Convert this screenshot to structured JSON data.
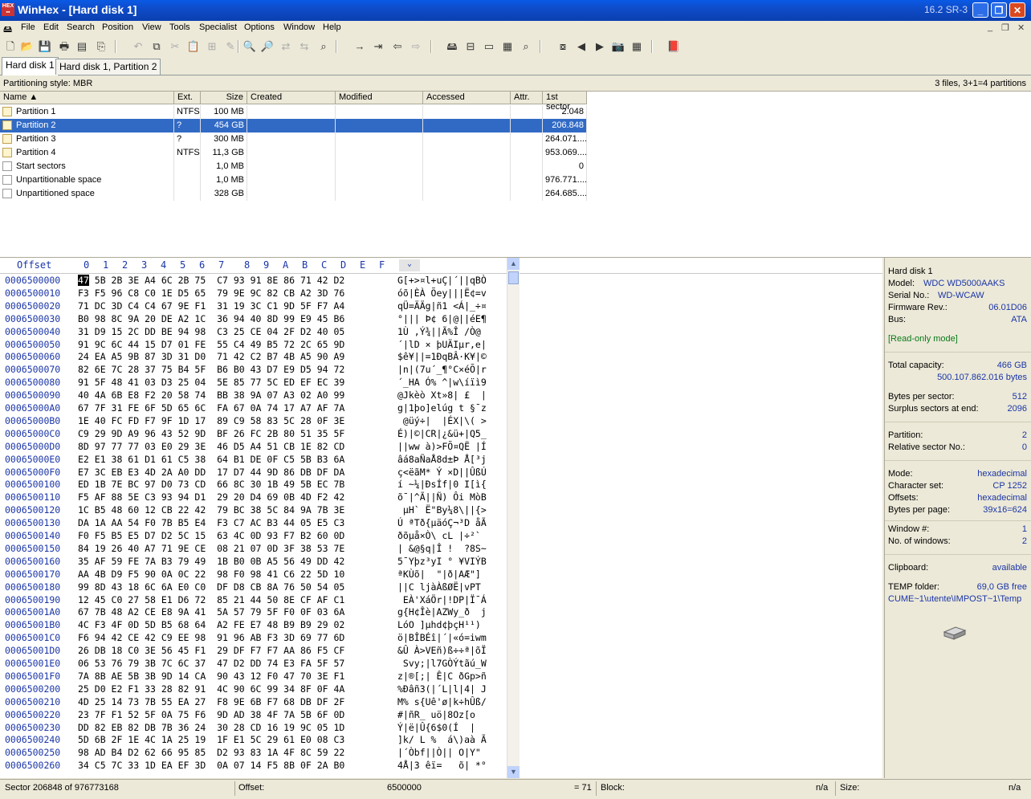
{
  "window": {
    "title": "WinHex - [Hard disk 1]",
    "version": "16.2 SR-3",
    "app_icon": "hex-icon"
  },
  "menu": [
    "File",
    "Edit",
    "Search",
    "Position",
    "View",
    "Tools",
    "Specialist",
    "Options",
    "Window",
    "Help"
  ],
  "tabs": [
    "Hard disk 1",
    "Hard disk 1, Partition 2"
  ],
  "partition_style": "Partitioning style: MBR",
  "files_summary": "3 files, 3+1=4 partitions",
  "columns": [
    "Name ▲",
    "Ext.",
    "Size",
    "Created",
    "Modified",
    "Accessed",
    "Attr.",
    "1st sector"
  ],
  "partitions": [
    {
      "name": "Partition 1",
      "ext": "NTFS",
      "size": "100 MB",
      "sector": "2.048",
      "icon": "partition-icon"
    },
    {
      "name": "Partition 2",
      "ext": "?",
      "size": "454 GB",
      "sector": "206.848",
      "icon": "partition-icon",
      "selected": true
    },
    {
      "name": "Partition 3",
      "ext": "?",
      "size": "300 MB",
      "sector": "264.071....",
      "icon": "partition-icon"
    },
    {
      "name": "Partition 4",
      "ext": "NTFS",
      "size": "11,3 GB",
      "sector": "953.069....",
      "icon": "partition-icon"
    },
    {
      "name": "Start sectors",
      "ext": "",
      "size": "1,0 MB",
      "sector": "0",
      "icon": "document-icon"
    },
    {
      "name": "Unpartitionable space",
      "ext": "",
      "size": "1,0 MB",
      "sector": "976.771....",
      "icon": "document-icon"
    },
    {
      "name": "Unpartitioned space",
      "ext": "",
      "size": "328 GB",
      "sector": "264.685....",
      "icon": "document-icon"
    }
  ],
  "hex_header": {
    "offset": "Offset",
    "cols": [
      "0",
      "1",
      "2",
      "3",
      "4",
      "5",
      "6",
      "7",
      "8",
      "9",
      "A",
      "B",
      "C",
      "D",
      "E",
      "F"
    ]
  },
  "hex_rows": [
    {
      "off": "0006500000",
      "hex": "47 5B 2B 3E A4 6C 2B 75  C7 93 91 8E 86 71 42 D2",
      "txt": "G[+>¤l+uÇ|´||qBÒ"
    },
    {
      "off": "0006500010",
      "hex": "F3 F5 96 C8 C0 1E D5 65  79 9E 9C 82 CB A2 3D 76",
      "txt": "óõ|ÈÀ Õey|||Ë¢=v"
    },
    {
      "off": "0006500020",
      "hex": "71 DC 3D C4 C4 67 9E F1  31 19 3C C1 9D 5F F7 A4",
      "txt": "qÜ=ÄÄg|ñ1 <Á|_÷¤"
    },
    {
      "off": "0006500030",
      "hex": "B0 98 8C 9A 20 DE A2 1C  36 94 40 8D 99 E9 45 B6",
      "txt": "°||| Þ¢ 6|@||éE¶"
    },
    {
      "off": "0006500040",
      "hex": "31 D9 15 2C DD BE 94 98  C3 25 CE 04 2F D2 40 05",
      "txt": "1Ù ,Ý¾||Ã%Î /Ò@ "
    },
    {
      "off": "0006500050",
      "hex": "91 9C 6C 44 15 D7 01 FE  55 C4 49 B5 72 2C 65 9D",
      "txt": "´|lD × þUÄIµr,e|"
    },
    {
      "off": "0006500060",
      "hex": "24 EA A5 9B 87 3D 31 D0  71 42 C2 B7 4B A5 90 A9",
      "txt": "$ê¥||=1ÐqBÂ·K¥|©"
    },
    {
      "off": "0006500070",
      "hex": "82 6E 7C 28 37 75 B4 5F  B6 B0 43 D7 E9 D5 94 72",
      "txt": "|n|(7u´_¶°C×éÕ|r"
    },
    {
      "off": "0006500080",
      "hex": "91 5F 48 41 03 D3 25 04  5E 85 77 5C ED EF EC 39",
      "txt": "´_HA Ó% ^|w\\íïì9"
    },
    {
      "off": "0006500090",
      "hex": "40 4A 6B E8 F2 20 58 74  BB 38 9A 07 A3 02 A0 99",
      "txt": "@Jkèò Xt»8| £  |"
    },
    {
      "off": "00065000A0",
      "hex": "67 7F 31 FE 6F 5D 65 6C  FA 67 0A 74 17 A7 AF 7A",
      "txt": "g|1þo]elúg t §¯z"
    },
    {
      "off": "00065000B0",
      "hex": "1E 40 FC FD F7 9F 1D 17  89 C9 58 83 5C 28 0F 3E",
      "txt": " @üý÷|  |ÉX|\\( >"
    },
    {
      "off": "00065000C0",
      "hex": "C9 29 9D A9 96 43 52 9D  BF 26 FC 2B 80 51 35 5F",
      "txt": "É)|©|CR|¿&ü+|Q5_"
    },
    {
      "off": "00065000D0",
      "hex": "8D 97 77 77 03 E0 29 3E  46 D5 A4 51 CB 1E 82 CD",
      "txt": "||ww à)>FÕ¤QË |Í"
    },
    {
      "off": "00065000E0",
      "hex": "E2 E1 38 61 D1 61 C5 38  64 B1 DE 0F C5 5B B3 6A",
      "txt": "âá8aÑaÅ8d±Þ Å[³j"
    },
    {
      "off": "00065000F0",
      "hex": "E7 3C EB E3 4D 2A A0 DD  17 D7 44 9D 86 DB DF DA",
      "txt": "ç<ëãM* Ý ×D||ÛßÚ"
    },
    {
      "off": "0006500100",
      "hex": "ED 1B 7E BC 97 D0 73 CD  66 8C 30 1B 49 5B EC 7B",
      "txt": "í ~¼|ÐsÍf|0 I[ì{"
    },
    {
      "off": "0006500110",
      "hex": "F5 AF 88 5E C3 93 94 D1  29 20 D4 69 0B 4D F2 42",
      "txt": "õ¯|^Ã||Ñ) Ôi MòB"
    },
    {
      "off": "0006500120",
      "hex": "1C B5 48 60 12 CB 22 42  79 BC 38 5C 84 9A 7B 3E",
      "txt": " µH` Ë\"By¼8\\||{>"
    },
    {
      "off": "0006500130",
      "hex": "DA 1A AA 54 F0 7B B5 E4  F3 C7 AC B3 44 05 E5 C3",
      "txt": "Ú ªTð{µäóÇ¬³D åÃ"
    },
    {
      "off": "0006500140",
      "hex": "F0 F5 B5 E5 D7 D2 5C 15  63 4C 0D 93 F7 B2 60 0D",
      "txt": "ðõµå×Ò\\ cL |÷²` "
    },
    {
      "off": "0006500150",
      "hex": "84 19 26 40 A7 71 9E CE  08 21 07 0D 3F 38 53 7E",
      "txt": "| &@§q|Î !  ?8S~"
    },
    {
      "off": "0006500160",
      "hex": "35 AF 59 FE 7A B3 79 49  1B B0 0B A5 56 49 DD 42",
      "txt": "5¯Yþz³yI ° ¥VIÝB"
    },
    {
      "off": "0006500170",
      "hex": "AA 4B D9 F5 90 0A 0C 22  98 F0 98 41 C6 22 5D 10",
      "txt": "ªKÙõ|  \"|ð|AÆ\"] "
    },
    {
      "off": "0006500180",
      "hex": "99 8D 43 18 6C 6A E0 C0  DF D8 CB 8A 76 50 54 05",
      "txt": "||C ljàÀßØË|vPT "
    },
    {
      "off": "0006500190",
      "hex": "12 45 C0 27 58 E1 D6 72  85 21 44 50 8E CF AF C1",
      "txt": " EÀ'XáÖr|!DP|Ï¯Á"
    },
    {
      "off": "00065001A0",
      "hex": "67 7B 48 A2 CE E8 9A 41  5A 57 79 5F F0 0F 03 6A",
      "txt": "g{H¢Îè|AZWy_ð  j"
    },
    {
      "off": "00065001B0",
      "hex": "4C F3 4F 0D 5D B5 68 64  A2 FE E7 48 B9 B9 29 02",
      "txt": "LóO ]µhd¢þçH¹¹) "
    },
    {
      "off": "00065001C0",
      "hex": "F6 94 42 CE 42 C9 EE 98  91 96 AB F3 3D 69 77 6D",
      "txt": "ö|BÎBÉî|´|«ó=iwm"
    },
    {
      "off": "00065001D0",
      "hex": "26 DB 18 C0 3E 56 45 F1  29 DF F7 F7 AA 86 F5 CF",
      "txt": "&Û À>VEñ)ß÷÷ª|õÏ"
    },
    {
      "off": "00065001E0",
      "hex": "06 53 76 79 3B 7C 6C 37  47 D2 DD 74 E3 FA 5F 57",
      "txt": " Svy;|l7GÒÝtãú_W"
    },
    {
      "off": "00065001F0",
      "hex": "7A 8B AE 5B 3B 9D 14 CA  90 43 12 F0 47 70 3E F1",
      "txt": "z|®[;| Ê|C ðGp>ñ"
    },
    {
      "off": "0006500200",
      "hex": "25 D0 E2 F1 33 28 82 91  4C 90 6C 99 34 8F 0F 4A",
      "txt": "%Ðâñ3(|´L|l|4| J"
    },
    {
      "off": "0006500210",
      "hex": "4D 25 14 73 7B 55 EA 27  F8 9E 6B F7 68 DB DF 2F",
      "txt": "M% s{Uê'ø|k÷hÛß/"
    },
    {
      "off": "0006500220",
      "hex": "23 7F F1 52 5F 0A 75 F6  9D AD 38 4F 7A 5B 6F 0D",
      "txt": "#|ñR_ uö|­8Oz[o "
    },
    {
      "off": "0006500230",
      "hex": "DD 82 EB 82 DB 7B 36 24  30 28 CD 16 19 9C 05 1D",
      "txt": "Ý|ë|Û{6$0(Í  | "
    },
    {
      "off": "0006500240",
      "hex": "5D 6B 2F 1E 4C 1A 25 19  1F E1 5C 29 61 E0 08 C3",
      "txt": "]k/ L %  á\\)aà Ã"
    },
    {
      "off": "0006500250",
      "hex": "98 AD B4 D2 62 66 95 85  D2 93 83 1A 4F 8C 59 22",
      "txt": "|­´Òbf||Ò|| O|Y\""
    },
    {
      "off": "0006500260",
      "hex": "34 C5 7C 33 1D EA EF 3D  0A 07 14 F5 8B 0F 2A B0",
      "txt": "4Å|3 êï=   õ| *°"
    }
  ],
  "info": {
    "disk": "Hard disk 1",
    "model_label": "Model:",
    "model": "WDC WD5000AAKS",
    "serial_label": "Serial No.:",
    "serial": "WD-WCAW",
    "firmware_label": "Firmware Rev.:",
    "firmware": "06.01D06",
    "bus_label": "Bus:",
    "bus": "ATA",
    "mode_note": "[Read-only mode]",
    "capacity_label": "Total capacity:",
    "capacity_gb": "466 GB",
    "capacity_bytes": "500.107.862.016 bytes",
    "bps_label": "Bytes per sector:",
    "bps": "512",
    "surplus_label": "Surplus sectors at end:",
    "surplus": "2096",
    "partition_label": "Partition:",
    "partition": "2",
    "relsector_label": "Relative sector No.:",
    "relsector": "0",
    "mode_label": "Mode:",
    "mode": "hexadecimal",
    "charset_label": "Character set:",
    "charset": "CP 1252",
    "offsets_label": "Offsets:",
    "offsets": "hexadecimal",
    "bpp_label": "Bytes per page:",
    "bpp": "39x16=624",
    "window_label": "Window #:",
    "window": "1",
    "nwin_label": "No. of windows:",
    "nwin": "2",
    "clipboard_label": "Clipboard:",
    "clipboard": "available",
    "temp_label": "TEMP folder:",
    "temp_free": "69,0 GB free",
    "temp_path": "CUME~1\\utente\\IMPOST~1\\Temp"
  },
  "status": {
    "sector": "Sector 206848 of 976773168",
    "offset_label": "Offset:",
    "offset": "6500000",
    "value": "= 71",
    "block_label": "Block:",
    "block": "n/a",
    "size_label": "Size:",
    "size": "n/a"
  }
}
